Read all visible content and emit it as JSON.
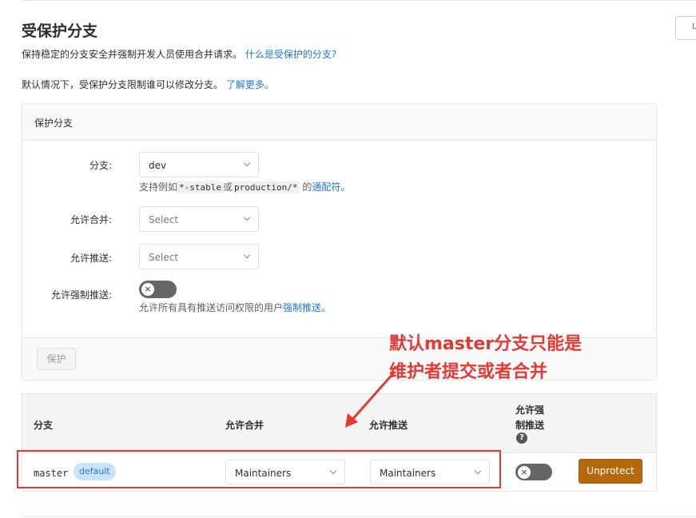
{
  "header": {
    "title": "受保护分支",
    "desc1_text": "保持稳定的分支安全并强制开发人员使用合并请求。",
    "desc1_link": "什么是受保护的分支?",
    "desc2_text": "默认情况下，受保护分支限制谁可以修改分支。",
    "desc2_link": "了解更多。"
  },
  "form": {
    "panel_title": "保护分支",
    "branch_label": "分支:",
    "branch_value": "dev",
    "hint_prefix": "支持例如",
    "hint_code1": "*-stable",
    "hint_or": "或",
    "hint_code2": "production/*",
    "hint_de": " 的",
    "hint_link": "通配符",
    "hint_end": "。",
    "merge_label": "允许合并:",
    "merge_placeholder": "Select",
    "push_label": "允许推送:",
    "push_placeholder": "Select",
    "force_label": "允许强制推送:",
    "force_hint_text": "允许所有具有推送访问权限的用户",
    "force_hint_link": "强制推送",
    "force_hint_end": "。",
    "toggle_glyph": "×",
    "protect_button": "保护"
  },
  "table": {
    "col_branch": "分支",
    "col_merge": "允许合并",
    "col_push": "允许推送",
    "col_force_line1": "允许强",
    "col_force_line2": "制推送",
    "help_glyph": "?",
    "row": {
      "branch": "master",
      "badge": "default",
      "merge": "Maintainers",
      "push": "Maintainers",
      "toggle_glyph": "×",
      "unprotect": "Unprotect"
    }
  },
  "annotation": {
    "line1": "默认master分支只能是",
    "line2": "维护者提交或者合并",
    "color": "#e53935"
  },
  "corner_button_text": "L"
}
